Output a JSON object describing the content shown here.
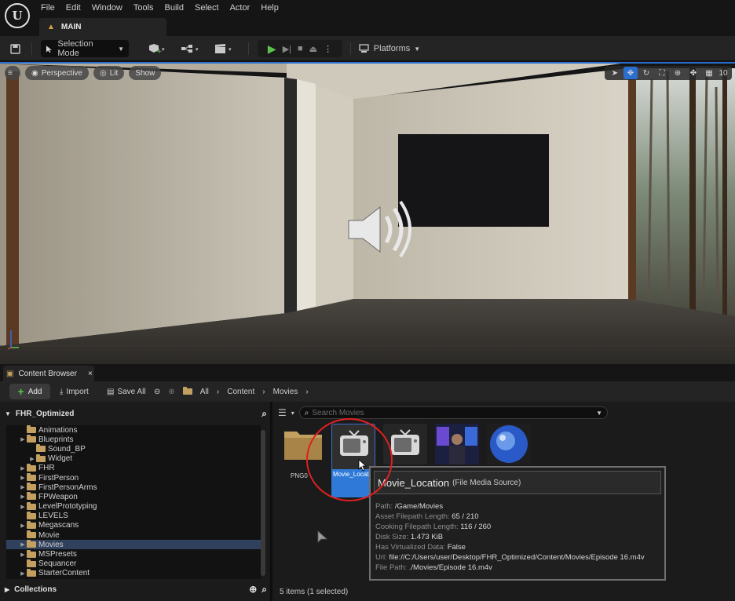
{
  "menu": [
    "File",
    "Edit",
    "Window",
    "Tools",
    "Build",
    "Select",
    "Actor",
    "Help"
  ],
  "logo_text": "U",
  "level_tab": {
    "label": "MAIN"
  },
  "toolbar": {
    "selection_mode": "Selection Mode",
    "platforms": "Platforms"
  },
  "viewport": {
    "perspective": "Perspective",
    "lit": "Lit",
    "show": "Show",
    "grid_value": "10"
  },
  "content_browser": {
    "tab_label": "Content Browser",
    "add": "Add",
    "import": "Import",
    "save_all": "Save All",
    "breadcrumb": [
      "All",
      "Content",
      "Movies"
    ],
    "root_folder": "FHR_Optimized",
    "tree": [
      {
        "label": "Animations",
        "indent": 1,
        "expander": false
      },
      {
        "label": "Blueprints",
        "indent": 1,
        "expander": true
      },
      {
        "label": "Sound_BP",
        "indent": 2,
        "expander": false
      },
      {
        "label": "Widget",
        "indent": 2,
        "expander": true
      },
      {
        "label": "FHR",
        "indent": 1,
        "expander": true
      },
      {
        "label": "FirstPerson",
        "indent": 1,
        "expander": true
      },
      {
        "label": "FirstPersonArms",
        "indent": 1,
        "expander": true
      },
      {
        "label": "FPWeapon",
        "indent": 1,
        "expander": true
      },
      {
        "label": "LevelPrototyping",
        "indent": 1,
        "expander": true
      },
      {
        "label": "LEVELS",
        "indent": 1,
        "expander": false
      },
      {
        "label": "Megascans",
        "indent": 1,
        "expander": true
      },
      {
        "label": "Movie",
        "indent": 1,
        "expander": false
      },
      {
        "label": "Movies",
        "indent": 1,
        "expander": true,
        "selected": true
      },
      {
        "label": "MSPresets",
        "indent": 1,
        "expander": true
      },
      {
        "label": "Sequancer",
        "indent": 1,
        "expander": false
      },
      {
        "label": "StarterContent",
        "indent": 1,
        "expander": true
      }
    ],
    "collections": "Collections",
    "search_placeholder": "Search Movies",
    "assets": {
      "png_label": "PNG0",
      "movie_location_label": "Movie_Location"
    },
    "status": "5 items (1 selected)"
  },
  "tooltip": {
    "name": "Movie_Location",
    "type": "(File Media Source)",
    "rows": [
      {
        "k": "Path:",
        "v": "/Game/Movies"
      },
      {
        "k": "Asset Filepath Length:",
        "v": "65 / 210"
      },
      {
        "k": "Cooking Filepath Length:",
        "v": "116 / 260"
      },
      {
        "k": "Disk Size:",
        "v": "1.473 KiB"
      },
      {
        "k": "Has Virtualized Data:",
        "v": "False"
      },
      {
        "k": "Url:",
        "v": "file://C:/Users/user/Desktop/FHR_Optimized/Content/Movies/Episode 16.m4v"
      },
      {
        "k": "File Path:",
        "v": "./Movies/Episode 16.m4v"
      }
    ]
  },
  "colors": {
    "accent": "#2a6fd0",
    "play_green": "#5bc24e",
    "folder": "#c4a060",
    "annotation_red": "#e02020"
  }
}
